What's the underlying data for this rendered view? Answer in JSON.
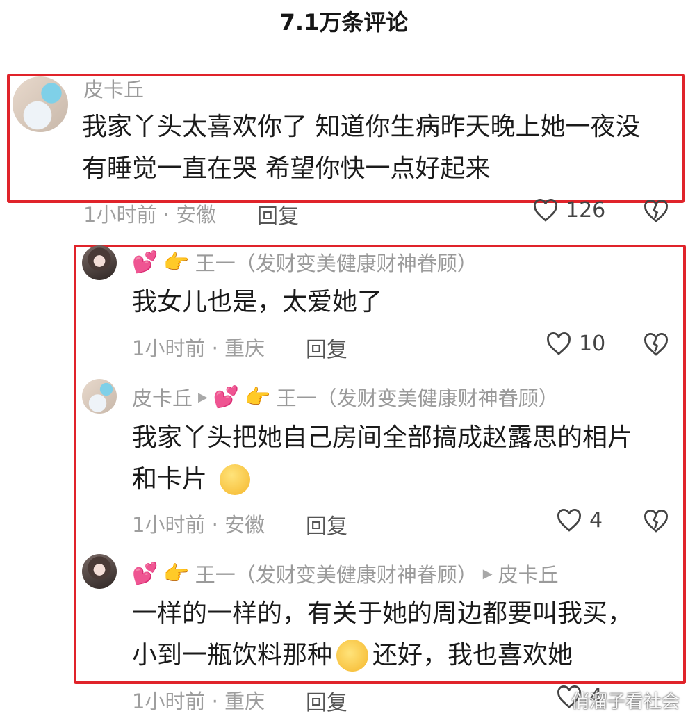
{
  "header": {
    "title": "7.1万条评论"
  },
  "comments": [
    {
      "user": "皮卡丘",
      "text_lines": [
        "我家丫头太喜欢你了 知道你生病昨天晚上她一夜没",
        "有睡觉一直在哭 希望你快一点好起来"
      ],
      "meta": "1小时前 · 安徽",
      "reply_label": "回复",
      "likes": "126"
    }
  ],
  "replies": [
    {
      "user": "王一（发财变美健康财神眷顾）",
      "text_lines": [
        "我女儿也是，太爱她了"
      ],
      "meta": "1小时前 · 重庆",
      "reply_label": "回复",
      "likes": "10"
    },
    {
      "user": "皮卡丘",
      "reply_to": "王一（发财变美健康财神眷顾）",
      "text_lines": [
        "我家丫头把她自己房间全部搞成赵露思的相片",
        "和卡片"
      ],
      "meta": "1小时前 · 安徽",
      "reply_label": "回复",
      "likes": "4"
    },
    {
      "user": "王一（发财变美健康财神眷顾）",
      "reply_to": "皮卡丘",
      "text_lines": [
        "一样的一样的，有关于她的周边都要叫我买，",
        "小到一瓶饮料那种",
        "还好，我也喜欢她"
      ],
      "meta": "1小时前 · 重庆",
      "reply_label": "回复",
      "likes": "4"
    }
  ],
  "watermark": "俏溜子看社会",
  "colors": {
    "highlight_box": "#e0232a",
    "meta_gray": "#9e9e9e"
  },
  "icons": [
    "heart-outline-icon",
    "broken-heart-icon",
    "pink-hearts-emoji",
    "pointing-hand-emoji",
    "reply-arrow-icon",
    "tired-face-emoji",
    "rofl-emoji"
  ]
}
